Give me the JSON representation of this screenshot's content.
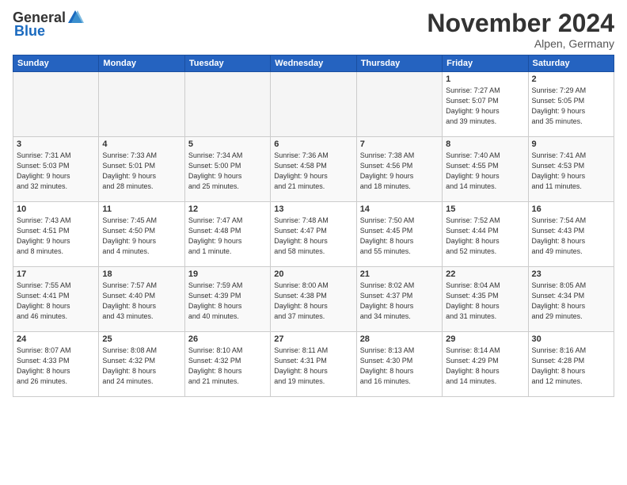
{
  "app": {
    "logo_general": "General",
    "logo_blue": "Blue",
    "month": "November 2024",
    "location": "Alpen, Germany"
  },
  "calendar": {
    "headers": [
      "Sunday",
      "Monday",
      "Tuesday",
      "Wednesday",
      "Thursday",
      "Friday",
      "Saturday"
    ],
    "weeks": [
      [
        {
          "day": "",
          "info": ""
        },
        {
          "day": "",
          "info": ""
        },
        {
          "day": "",
          "info": ""
        },
        {
          "day": "",
          "info": ""
        },
        {
          "day": "",
          "info": ""
        },
        {
          "day": "1",
          "info": "Sunrise: 7:27 AM\nSunset: 5:07 PM\nDaylight: 9 hours\nand 39 minutes."
        },
        {
          "day": "2",
          "info": "Sunrise: 7:29 AM\nSunset: 5:05 PM\nDaylight: 9 hours\nand 35 minutes."
        }
      ],
      [
        {
          "day": "3",
          "info": "Sunrise: 7:31 AM\nSunset: 5:03 PM\nDaylight: 9 hours\nand 32 minutes."
        },
        {
          "day": "4",
          "info": "Sunrise: 7:33 AM\nSunset: 5:01 PM\nDaylight: 9 hours\nand 28 minutes."
        },
        {
          "day": "5",
          "info": "Sunrise: 7:34 AM\nSunset: 5:00 PM\nDaylight: 9 hours\nand 25 minutes."
        },
        {
          "day": "6",
          "info": "Sunrise: 7:36 AM\nSunset: 4:58 PM\nDaylight: 9 hours\nand 21 minutes."
        },
        {
          "day": "7",
          "info": "Sunrise: 7:38 AM\nSunset: 4:56 PM\nDaylight: 9 hours\nand 18 minutes."
        },
        {
          "day": "8",
          "info": "Sunrise: 7:40 AM\nSunset: 4:55 PM\nDaylight: 9 hours\nand 14 minutes."
        },
        {
          "day": "9",
          "info": "Sunrise: 7:41 AM\nSunset: 4:53 PM\nDaylight: 9 hours\nand 11 minutes."
        }
      ],
      [
        {
          "day": "10",
          "info": "Sunrise: 7:43 AM\nSunset: 4:51 PM\nDaylight: 9 hours\nand 8 minutes."
        },
        {
          "day": "11",
          "info": "Sunrise: 7:45 AM\nSunset: 4:50 PM\nDaylight: 9 hours\nand 4 minutes."
        },
        {
          "day": "12",
          "info": "Sunrise: 7:47 AM\nSunset: 4:48 PM\nDaylight: 9 hours\nand 1 minute."
        },
        {
          "day": "13",
          "info": "Sunrise: 7:48 AM\nSunset: 4:47 PM\nDaylight: 8 hours\nand 58 minutes."
        },
        {
          "day": "14",
          "info": "Sunrise: 7:50 AM\nSunset: 4:45 PM\nDaylight: 8 hours\nand 55 minutes."
        },
        {
          "day": "15",
          "info": "Sunrise: 7:52 AM\nSunset: 4:44 PM\nDaylight: 8 hours\nand 52 minutes."
        },
        {
          "day": "16",
          "info": "Sunrise: 7:54 AM\nSunset: 4:43 PM\nDaylight: 8 hours\nand 49 minutes."
        }
      ],
      [
        {
          "day": "17",
          "info": "Sunrise: 7:55 AM\nSunset: 4:41 PM\nDaylight: 8 hours\nand 46 minutes."
        },
        {
          "day": "18",
          "info": "Sunrise: 7:57 AM\nSunset: 4:40 PM\nDaylight: 8 hours\nand 43 minutes."
        },
        {
          "day": "19",
          "info": "Sunrise: 7:59 AM\nSunset: 4:39 PM\nDaylight: 8 hours\nand 40 minutes."
        },
        {
          "day": "20",
          "info": "Sunrise: 8:00 AM\nSunset: 4:38 PM\nDaylight: 8 hours\nand 37 minutes."
        },
        {
          "day": "21",
          "info": "Sunrise: 8:02 AM\nSunset: 4:37 PM\nDaylight: 8 hours\nand 34 minutes."
        },
        {
          "day": "22",
          "info": "Sunrise: 8:04 AM\nSunset: 4:35 PM\nDaylight: 8 hours\nand 31 minutes."
        },
        {
          "day": "23",
          "info": "Sunrise: 8:05 AM\nSunset: 4:34 PM\nDaylight: 8 hours\nand 29 minutes."
        }
      ],
      [
        {
          "day": "24",
          "info": "Sunrise: 8:07 AM\nSunset: 4:33 PM\nDaylight: 8 hours\nand 26 minutes."
        },
        {
          "day": "25",
          "info": "Sunrise: 8:08 AM\nSunset: 4:32 PM\nDaylight: 8 hours\nand 24 minutes."
        },
        {
          "day": "26",
          "info": "Sunrise: 8:10 AM\nSunset: 4:32 PM\nDaylight: 8 hours\nand 21 minutes."
        },
        {
          "day": "27",
          "info": "Sunrise: 8:11 AM\nSunset: 4:31 PM\nDaylight: 8 hours\nand 19 minutes."
        },
        {
          "day": "28",
          "info": "Sunrise: 8:13 AM\nSunset: 4:30 PM\nDaylight: 8 hours\nand 16 minutes."
        },
        {
          "day": "29",
          "info": "Sunrise: 8:14 AM\nSunset: 4:29 PM\nDaylight: 8 hours\nand 14 minutes."
        },
        {
          "day": "30",
          "info": "Sunrise: 8:16 AM\nSunset: 4:28 PM\nDaylight: 8 hours\nand 12 minutes."
        }
      ]
    ]
  }
}
